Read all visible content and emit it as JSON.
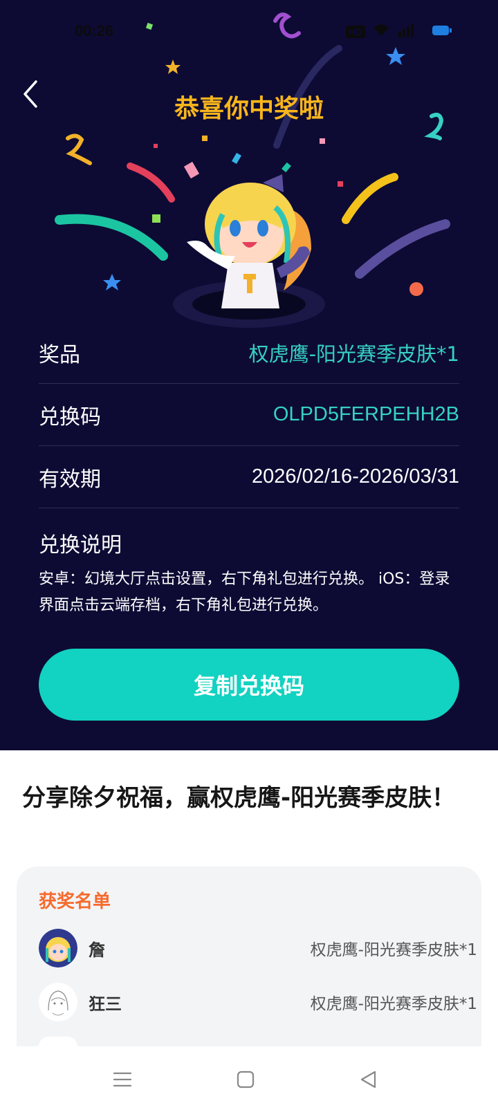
{
  "status_bar": {
    "time": "00:26",
    "hd_badge": "HD"
  },
  "header": {
    "title": "恭喜你中奖啦"
  },
  "prize_info": {
    "rows": [
      {
        "label": "奖品",
        "value": "权虎鹰-阳光赛季皮肤*1"
      },
      {
        "label": "兑换码",
        "value": "OLPD5FERPEHH2B"
      },
      {
        "label": "有效期",
        "value": "2026/02/16-2026/03/31"
      }
    ],
    "instructions_title": "兑换说明",
    "instructions_text": "安卓：幻境大厅点击设置，右下角礼包进行兑换。 iOS：登录界面点击云端存档，右下角礼包进行兑换。"
  },
  "copy_button": {
    "label": "复制兑换码"
  },
  "share": {
    "title": "分享除夕祝福，赢权虎鹰-阳光赛季皮肤！"
  },
  "winners": {
    "title": "获奖名单",
    "list": [
      {
        "name": "詹",
        "prize": "权虎鹰-阳光赛季皮肤*1"
      },
      {
        "name": "狂三",
        "prize": "权虎鹰-阳光赛季皮肤*1"
      }
    ]
  },
  "colors": {
    "background_dark": "#0d0b34",
    "title_gold": "#f9b51c",
    "accent_teal": "#12d2c1",
    "winners_orange": "#f66a2c"
  },
  "icons": [
    "back-arrow-icon",
    "hd-icon",
    "wifi-icon",
    "signal-icon",
    "battery-icon",
    "menu-icon",
    "home-icon",
    "back-icon"
  ]
}
